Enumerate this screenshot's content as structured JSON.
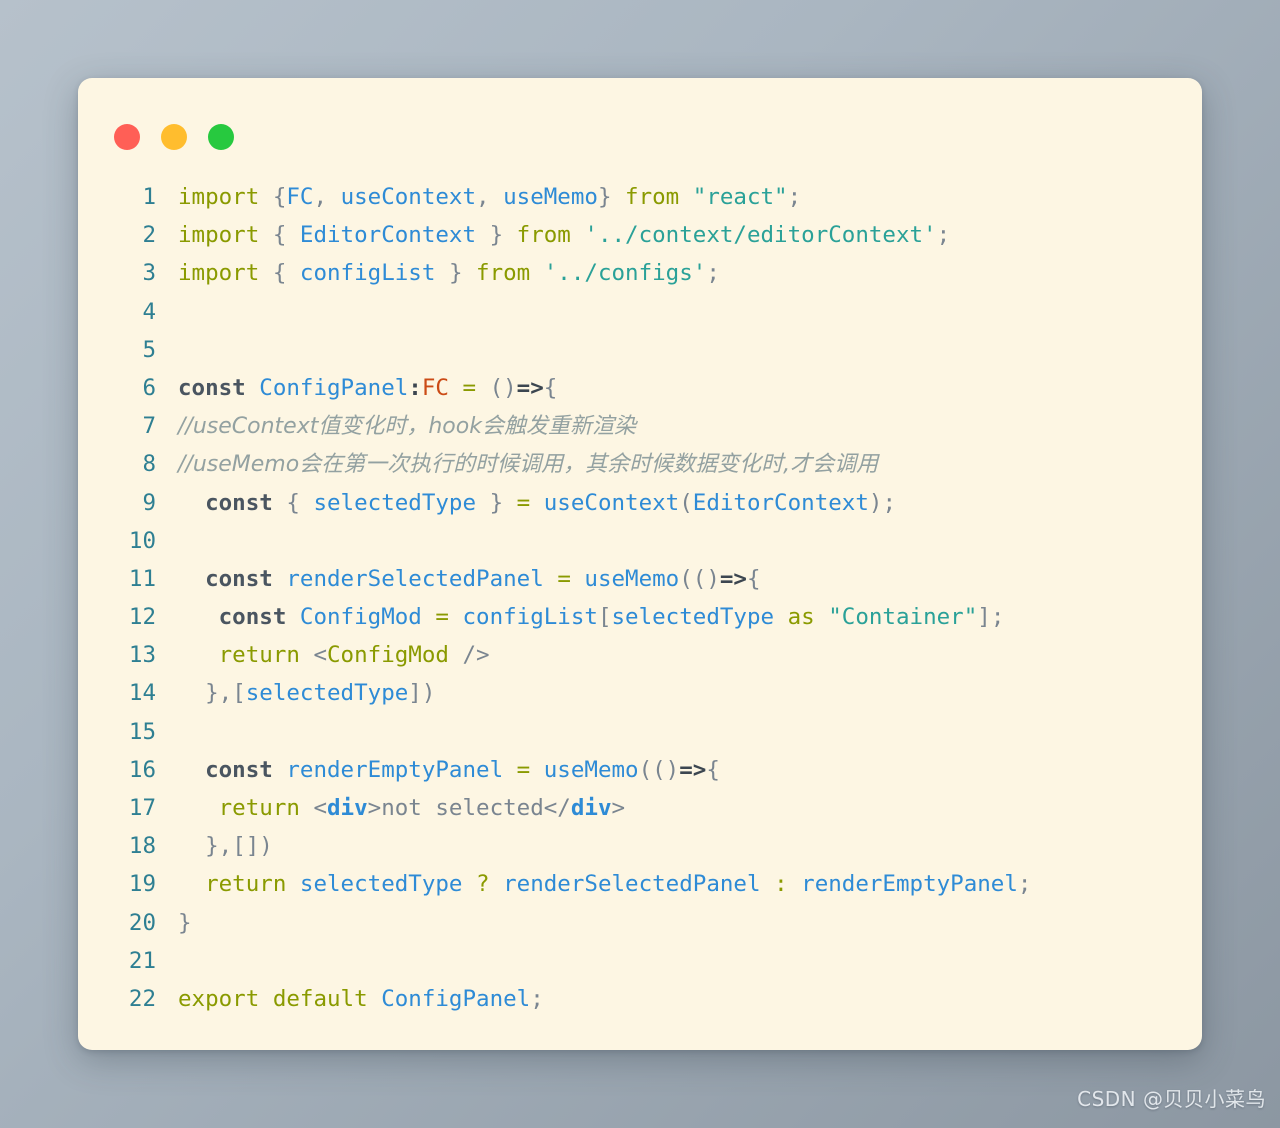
{
  "window": {
    "controls": [
      {
        "name": "close",
        "color": "#ff5f56"
      },
      {
        "name": "minimize",
        "color": "#ffbd2e"
      },
      {
        "name": "maximize",
        "color": "#27c93f"
      }
    ]
  },
  "theme": {
    "card_background": "#fdf6e3",
    "page_background_start": "#b6c1cb",
    "page_background_end": "#8c97a2",
    "keyword_color": "#8a9a00",
    "identifier_color": "#2e8bd6",
    "string_color": "#2aa198",
    "comment_color": "#93a1a1",
    "type_color": "#cb4b16",
    "line_number_color": "#2e7f92"
  },
  "editor": {
    "language": "TypeScript React",
    "line_numbers": [
      "1",
      "2",
      "3",
      "4",
      "5",
      "6",
      "7",
      "8",
      "9",
      "10",
      "11",
      "12",
      "13",
      "14",
      "15",
      "16",
      "17",
      "18",
      "19",
      "20",
      "21",
      "22"
    ],
    "lines": [
      "import {FC, useContext, useMemo} from \"react\";",
      "import { EditorContext } from '../context/editorContext';",
      "import { configList } from '../configs';",
      "",
      "",
      "const ConfigPanel:FC = ()=>{",
      "   //useContext值变化时，hook会触发重新渲染",
      "  //useMemo会在第一次执行的时候调用，其余时候数据变化时,才会调用",
      "  const { selectedType } = useContext(EditorContext);",
      "",
      "  const renderSelectedPanel = useMemo(()=>{",
      "    const ConfigMod = configList[selectedType as \"Container\"];",
      "    return <ConfigMod />",
      "  },[selectedType])",
      "",
      "  const renderEmptyPanel = useMemo(()=>{",
      "    return <div>not selected</div>",
      "  },[])",
      "  return selectedType ? renderSelectedPanel : renderEmptyPanel;",
      "}",
      "",
      "export default ConfigPanel;"
    ],
    "tokens": {
      "l1": {
        "import": "import",
        "brace_open": "{",
        "fc": "FC",
        "comma1": ", ",
        "useContext": "useContext",
        "comma2": ", ",
        "useMemo": "useMemo",
        "brace_close": "}",
        "from": "from",
        "module": "\"react\"",
        "semi": ";"
      },
      "l2": {
        "import": "import",
        "brace_open": "{",
        "name": "EditorContext",
        "brace_close": "}",
        "from": "from",
        "module": "'../context/editorContext'",
        "semi": ";"
      },
      "l3": {
        "import": "import",
        "brace_open": "{",
        "name": "configList",
        "brace_close": "}",
        "from": "from",
        "module": "'../configs'",
        "semi": ";"
      },
      "l6": {
        "const": "const",
        "name": "ConfigPanel",
        "colon": ":",
        "type": "FC",
        "eq": "=",
        "parens": "()",
        "arrow": "=>",
        "brace": "{"
      },
      "l7": {
        "comment": "//useContext值变化时，hook会触发重新渲染"
      },
      "l8": {
        "comment": "//useMemo会在第一次执行的时候调用，其余时候数据变化时,才会调用"
      },
      "l9": {
        "const": "const",
        "brace_open": "{",
        "prop": "selectedType",
        "brace_close": "}",
        "eq": "=",
        "call": "useContext",
        "paren_open": "(",
        "arg": "EditorContext",
        "paren_close": ")",
        "semi": ";"
      },
      "l11": {
        "const": "const",
        "name": "renderSelectedPanel",
        "eq": "=",
        "call": "useMemo",
        "parens": "(()",
        "arrow": "=>",
        "brace": "{"
      },
      "l12": {
        "const": "const",
        "name": "ConfigMod",
        "eq": "=",
        "obj": "configList",
        "bracket_open": "[",
        "key": "selectedType",
        "as": "as",
        "str": "\"Container\"",
        "bracket_close": "]",
        "semi": ";"
      },
      "l13": {
        "return": "return",
        "lt": "<",
        "tag": "ConfigMod",
        "close": "/>"
      },
      "l14": {
        "brace": "}",
        "comma": ",",
        "bracket_open": "[",
        "dep": "selectedType",
        "bracket_close": "]",
        "paren": ")"
      },
      "l16": {
        "const": "const",
        "name": "renderEmptyPanel",
        "eq": "=",
        "call": "useMemo",
        "parens": "(()",
        "arrow": "=>",
        "brace": "{"
      },
      "l17": {
        "return": "return",
        "lt": "<",
        "tag": "div",
        "gt": ">",
        "text": "not selected",
        "closelt": "</",
        "tag2": "div",
        "closegt": ">"
      },
      "l18": {
        "brace": "}",
        "comma": ",",
        "brackets": "[]",
        "paren": ")"
      },
      "l19": {
        "return": "return",
        "cond": "selectedType",
        "q": "?",
        "a": "renderSelectedPanel",
        "colon": ":",
        "b": "renderEmptyPanel",
        "semi": ";"
      },
      "l20": {
        "brace": "}"
      },
      "l22": {
        "export": "export",
        "default": "default",
        "name": "ConfigPanel",
        "semi": ";"
      }
    }
  },
  "watermark": {
    "text": "CSDN @贝贝小菜鸟"
  }
}
